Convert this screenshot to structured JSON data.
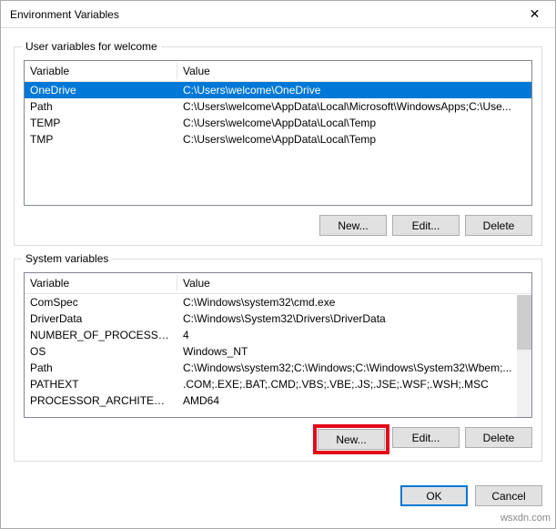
{
  "titlebar": {
    "title": "Environment Variables"
  },
  "user_section": {
    "legend": "User variables for welcome",
    "columns": {
      "c1": "Variable",
      "c2": "Value"
    },
    "rows": [
      {
        "name": "OneDrive",
        "value": "C:\\Users\\welcome\\OneDrive",
        "selected": true
      },
      {
        "name": "Path",
        "value": "C:\\Users\\welcome\\AppData\\Local\\Microsoft\\WindowsApps;C:\\Use...",
        "selected": false
      },
      {
        "name": "TEMP",
        "value": "C:\\Users\\welcome\\AppData\\Local\\Temp",
        "selected": false
      },
      {
        "name": "TMP",
        "value": "C:\\Users\\welcome\\AppData\\Local\\Temp",
        "selected": false
      }
    ],
    "buttons": {
      "new": "New...",
      "edit": "Edit...",
      "del": "Delete"
    }
  },
  "system_section": {
    "legend": "System variables",
    "columns": {
      "c1": "Variable",
      "c2": "Value"
    },
    "rows": [
      {
        "name": "ComSpec",
        "value": "C:\\Windows\\system32\\cmd.exe"
      },
      {
        "name": "DriverData",
        "value": "C:\\Windows\\System32\\Drivers\\DriverData"
      },
      {
        "name": "NUMBER_OF_PROCESSORS",
        "value": "4"
      },
      {
        "name": "OS",
        "value": "Windows_NT"
      },
      {
        "name": "Path",
        "value": "C:\\Windows\\system32;C:\\Windows;C:\\Windows\\System32\\Wbem;..."
      },
      {
        "name": "PATHEXT",
        "value": ".COM;.EXE;.BAT;.CMD;.VBS;.VBE;.JS;.JSE;.WSF;.WSH;.MSC"
      },
      {
        "name": "PROCESSOR_ARCHITECTURE",
        "value": "AMD64"
      }
    ],
    "buttons": {
      "new": "New...",
      "edit": "Edit...",
      "del": "Delete"
    }
  },
  "footer": {
    "ok": "OK",
    "cancel": "Cancel"
  },
  "watermark": "wsxdn.com"
}
